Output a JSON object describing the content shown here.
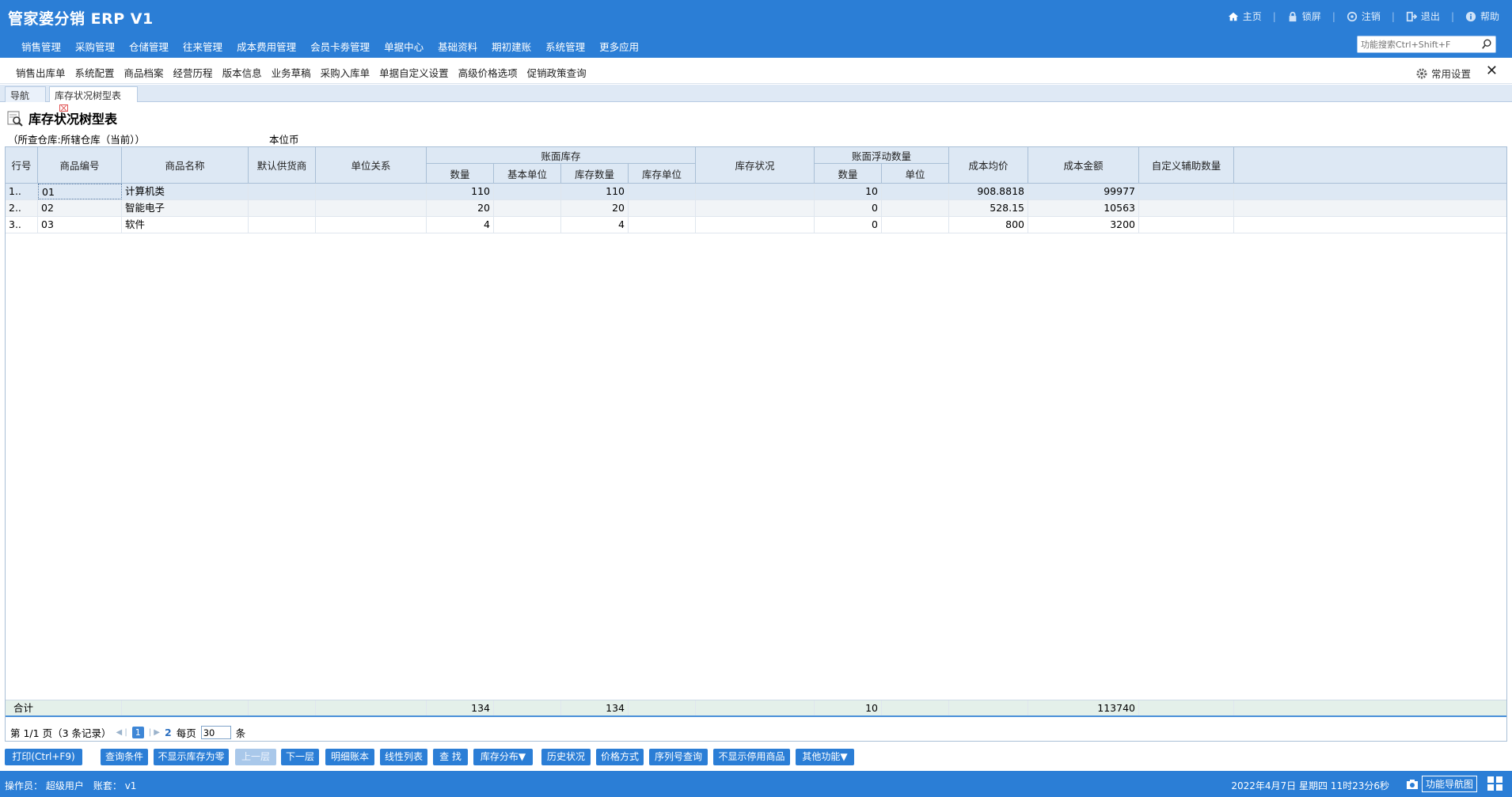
{
  "app": {
    "title": "管家婆分销 ERP V1"
  },
  "top_links": [
    {
      "label": "主页",
      "icon": "home-icon"
    },
    {
      "label": "锁屏",
      "icon": "lock-icon"
    },
    {
      "label": "注销",
      "icon": "logout-icon"
    },
    {
      "label": "退出",
      "icon": "exit-icon"
    },
    {
      "label": "帮助",
      "icon": "help-icon"
    }
  ],
  "main_nav": [
    "销售管理",
    "采购管理",
    "仓储管理",
    "往来管理",
    "成本费用管理",
    "会员卡劵管理",
    "单据中心",
    "基础资料",
    "期初建账",
    "系统管理",
    "更多应用"
  ],
  "search": {
    "placeholder": "功能搜索Ctrl+Shift+F"
  },
  "quick_items": [
    "销售出库单",
    "系统配置",
    "商品档案",
    "经营历程",
    "版本信息",
    "业务草稿",
    "采购入库单",
    "单据自定义设置",
    "高级价格选项",
    "促销政策查询"
  ],
  "common_settings": "常用设置",
  "tabs": [
    "导航",
    "库存状况树型表"
  ],
  "page": {
    "title": "库存状况树型表",
    "subinfo": "（所查仓库:所辖仓库（当前））",
    "currency": "本位币"
  },
  "table": {
    "headers": {
      "row_no": "行号",
      "code": "商品编号",
      "name": "商品名称",
      "supplier": "默认供货商",
      "unit_rel": "单位关系",
      "book_stock": "账面库存",
      "qty": "数量",
      "base_unit": "基本单位",
      "stock_qty": "库存数量",
      "stock_unit": "库存单位",
      "status": "库存状况",
      "float_qty_group": "账面浮动数量",
      "float_qty": "数量",
      "float_unit": "单位",
      "avg_cost": "成本均价",
      "cost_amount": "成本金额",
      "custom_qty": "自定义辅助数量"
    },
    "rows": [
      {
        "no": "1..",
        "code": "01",
        "name": "计算机类",
        "qty": "110",
        "stock_qty": "110",
        "float_qty": "10",
        "avg_cost": "908.8818",
        "cost_amount": "99977"
      },
      {
        "no": "2..",
        "code": "02",
        "name": "智能电子",
        "qty": "20",
        "stock_qty": "20",
        "float_qty": "0",
        "avg_cost": "528.15",
        "cost_amount": "10563"
      },
      {
        "no": "3..",
        "code": "03",
        "name": "软件",
        "qty": "4",
        "stock_qty": "4",
        "float_qty": "0",
        "avg_cost": "800",
        "cost_amount": "3200"
      }
    ],
    "total": {
      "label": "合计",
      "qty": "134",
      "stock_qty": "134",
      "float_qty": "10",
      "cost_amount": "113740"
    }
  },
  "pager": {
    "info": "第 1/1 页（3 条记录）",
    "current": "1",
    "next": "2",
    "per_page_label": "每页",
    "per_page": "30",
    "unit": "条"
  },
  "buttons": [
    {
      "label": "打印(Ctrl+F9)",
      "disabled": false
    },
    {
      "label": "查询条件",
      "disabled": false
    },
    {
      "label": "不显示库存为零",
      "disabled": false
    },
    {
      "label": "上一层",
      "disabled": true
    },
    {
      "label": "下一层",
      "disabled": false
    },
    {
      "label": "明细账本",
      "disabled": false
    },
    {
      "label": "线性列表",
      "disabled": false
    },
    {
      "label": "查 找",
      "disabled": false
    },
    {
      "label": "库存分布▼",
      "disabled": false
    },
    {
      "label": "历史状况",
      "disabled": false
    },
    {
      "label": "价格方式",
      "disabled": false
    },
    {
      "label": "序列号查询",
      "disabled": false
    },
    {
      "label": "不显示停用商品",
      "disabled": false
    },
    {
      "label": "其他功能▼",
      "disabled": false
    }
  ],
  "status": {
    "operator_label": "操作员：",
    "operator": "超级用户",
    "account_label": "账套：",
    "account": "v1",
    "datetime": "2022年4月7日  星期四  11时23分6秒",
    "nav_btn": "功能导航图"
  }
}
